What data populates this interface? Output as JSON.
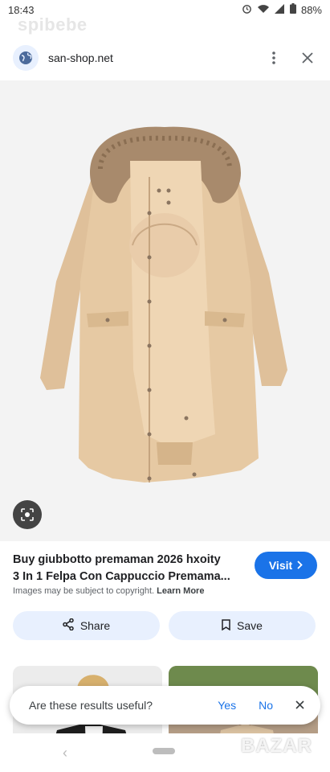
{
  "status_bar": {
    "time": "18:43",
    "battery": "88%"
  },
  "watermark": "spibebe",
  "browser": {
    "url": "san-shop.net"
  },
  "result": {
    "title_line1": "Buy giubbotto premaman 2026 hxoity",
    "title_line2": "3 In 1 Felpa Con Cappuccio Premama...",
    "visit_label": "Visit",
    "copyright_text": "Images may be subject to copyright.",
    "learn_more": "Learn More"
  },
  "actions": {
    "share_label": "Share",
    "save_label": "Save"
  },
  "feedback": {
    "question": "Are these results useful?",
    "yes_label": "Yes",
    "no_label": "No"
  },
  "overlay_watermark": "BAZAR",
  "colors": {
    "accent": "#1a73e8",
    "chip_bg": "#e8f0fe",
    "coat": "#e6c9a3",
    "fur": "#a88a6c"
  }
}
